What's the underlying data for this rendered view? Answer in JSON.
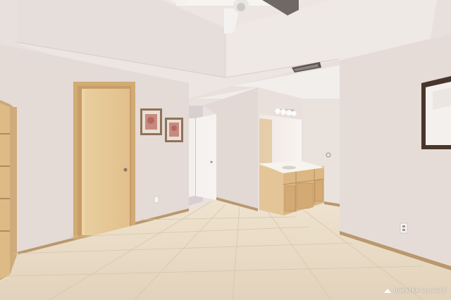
{
  "image": {
    "kind": "photo",
    "subject": "empty bedroom with tiled floor, wooden door, framed pictures, and an open bathroom with vanity and mirror"
  },
  "watermark": {
    "text": "GREATER ALLIANCE"
  },
  "colors": {
    "wall": "#e4dad6",
    "ceiling": "#ece6e3",
    "floor": "#e6d8c2",
    "wood": "#e6c79a",
    "trim": "#c79f72",
    "mirror_frame": "#4a352b"
  }
}
